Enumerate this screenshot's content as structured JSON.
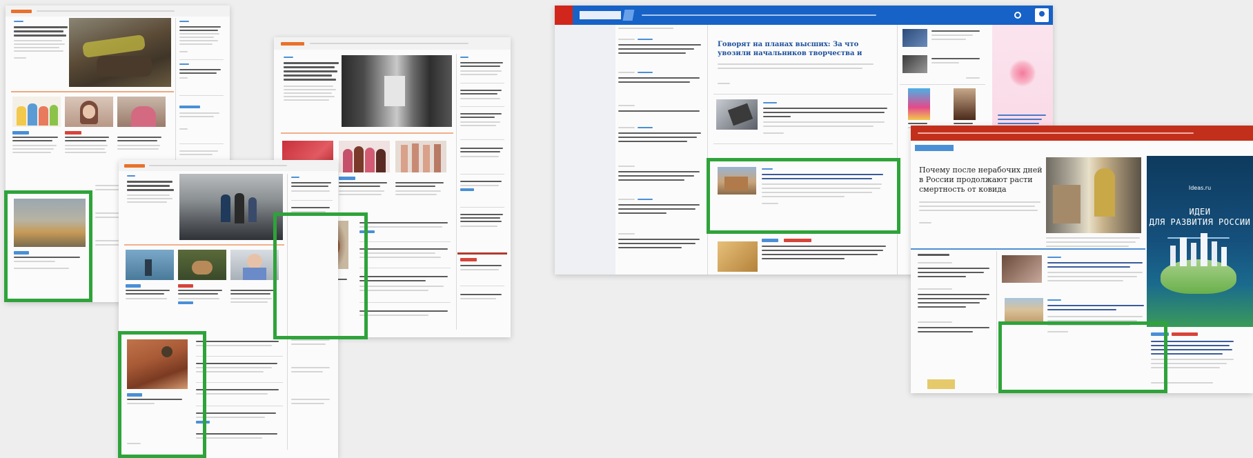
{
  "screens": [
    {
      "id": "s1"
    },
    {
      "id": "s2"
    },
    {
      "id": "s3"
    },
    {
      "id": "s4"
    },
    {
      "id": "s5"
    },
    {
      "id": "s6"
    }
  ],
  "colors": {
    "highlight": "#2ea33a",
    "brand_orange": "#e8712b",
    "brand_blue": "#1762c7",
    "brand_red": "#c2301c",
    "tag_blue": "#4a8fd6",
    "tag_red": "#d7443a"
  },
  "s5": {
    "headline": "Почему после нерабочих дней в России продолжают расти смертность от ковида",
    "ad_main": "ИДЕИ\nДЛЯ РАЗВИТИЯ РОССИИ",
    "ad_top": "Ideas.ru"
  },
  "s4": {
    "headline": "Говорят на планах высших: За что увозили начальников творчества и кто их сменил"
  }
}
